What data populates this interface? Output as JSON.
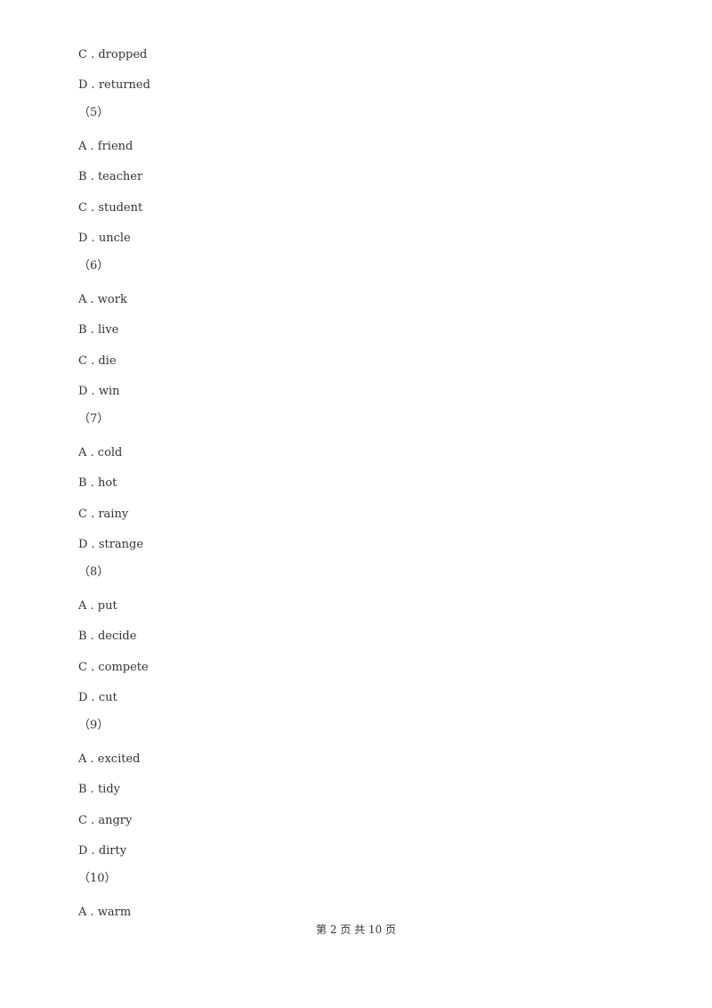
{
  "items": [
    {
      "type": "option",
      "text": "C . dropped"
    },
    {
      "type": "option",
      "text": "D . returned"
    },
    {
      "type": "question",
      "text": "（5）"
    },
    {
      "type": "option",
      "text": "A . friend"
    },
    {
      "type": "option",
      "text": "B . teacher"
    },
    {
      "type": "option",
      "text": "C . student"
    },
    {
      "type": "option",
      "text": "D . uncle"
    },
    {
      "type": "question",
      "text": "（6）"
    },
    {
      "type": "option",
      "text": "A . work"
    },
    {
      "type": "option",
      "text": "B . live"
    },
    {
      "type": "option",
      "text": "C . die"
    },
    {
      "type": "option",
      "text": "D . win"
    },
    {
      "type": "question",
      "text": "（7）"
    },
    {
      "type": "option",
      "text": "A . cold"
    },
    {
      "type": "option",
      "text": "B . hot"
    },
    {
      "type": "option",
      "text": "C . rainy"
    },
    {
      "type": "option",
      "text": "D . strange"
    },
    {
      "type": "question",
      "text": "（8）"
    },
    {
      "type": "option",
      "text": "A . put"
    },
    {
      "type": "option",
      "text": "B . decide"
    },
    {
      "type": "option",
      "text": "C . compete"
    },
    {
      "type": "option",
      "text": "D . cut"
    },
    {
      "type": "question",
      "text": "（9）"
    },
    {
      "type": "option",
      "text": "A . excited"
    },
    {
      "type": "option",
      "text": "B . tidy"
    },
    {
      "type": "option",
      "text": "C . angry"
    },
    {
      "type": "option",
      "text": "D . dirty"
    },
    {
      "type": "question",
      "text": "（10）"
    },
    {
      "type": "option",
      "text": "A . warm"
    }
  ],
  "footer": {
    "text": "第 2 页 共 10 页"
  }
}
